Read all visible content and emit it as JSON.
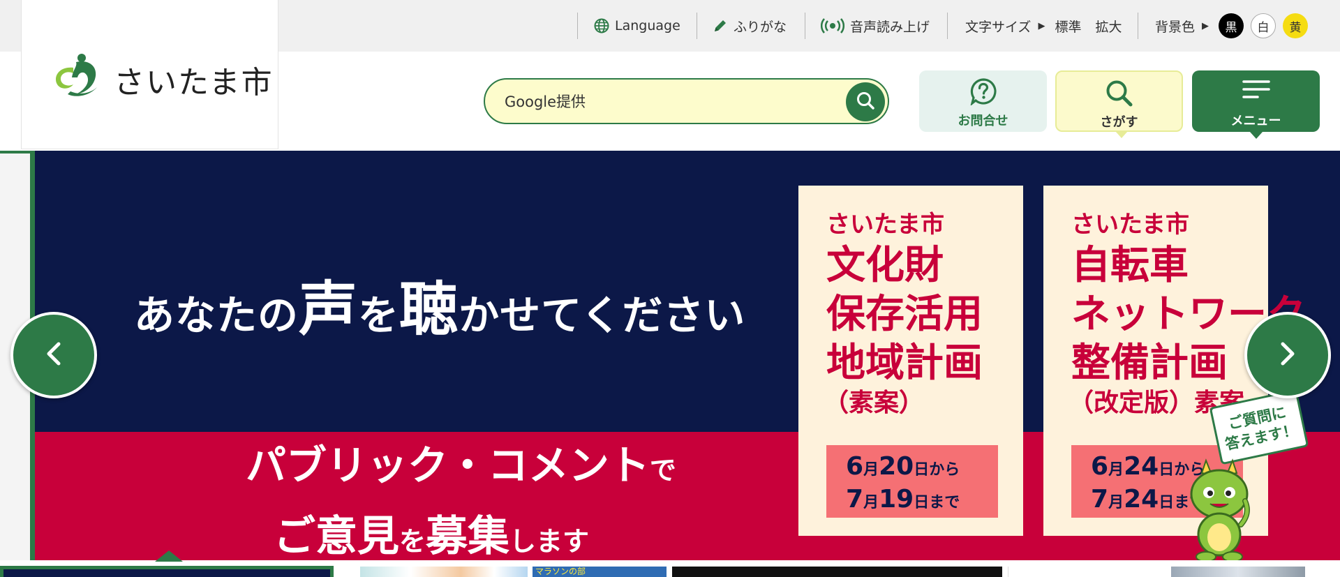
{
  "utility_bar": {
    "language": "Language",
    "furigana": "ふりがな",
    "read_aloud": "音声読み上げ",
    "text_size_label": "文字サイズ",
    "text_size_options": [
      "標準",
      "拡大"
    ],
    "bg_color_label": "背景色",
    "bg_color_options": [
      "黒",
      "白",
      "黄"
    ]
  },
  "header": {
    "logo_text": "さいたま市",
    "search_placeholder": "Google提供",
    "contact_label": "お問合せ",
    "find_label": "さがす",
    "menu_label": "メニュー"
  },
  "hero": {
    "headline_parts": [
      "あなたの",
      "声",
      "を",
      "聴",
      "かせてください"
    ],
    "sub_line1": [
      "パブリック・コメント",
      "で"
    ],
    "sub_line2": [
      "ご意見",
      "を",
      "募集",
      "します"
    ],
    "cards": [
      {
        "city": "さいたま市",
        "title_lines": [
          "文化財",
          "保存活用",
          "地域計画"
        ],
        "note": "（素案）",
        "date_lines": [
          [
            "6",
            "月",
            "20",
            "日から"
          ],
          [
            "7",
            "月",
            "19",
            "日まで"
          ]
        ]
      },
      {
        "city": "さいたま市",
        "title_lines": [
          "自転車",
          "ネットワーク",
          "整備計画"
        ],
        "note": "（改定版）素案",
        "date_lines": [
          [
            "6",
            "月",
            "24",
            "日から"
          ],
          [
            "7",
            "月",
            "24",
            "日まで"
          ]
        ]
      }
    ],
    "speech_bubble": [
      "ご質問に",
      "答えます！"
    ]
  },
  "thumbnails": {
    "marathon_label": "マラソンの部"
  },
  "colors": {
    "brand_green": "#2d7a47",
    "hero_navy": "#0c1848",
    "hero_red": "#c8003a",
    "card_bg": "#fef2dc",
    "date_bg": "#f57074",
    "search_bg": "#fdfccc"
  },
  "icons": {
    "language": "globe-icon",
    "furigana": "pencil-icon",
    "read_aloud": "broadcast-icon",
    "search": "magnifier-icon",
    "contact": "question-bubble-icon",
    "find": "magnifier-icon",
    "menu": "hamburger-icon",
    "prev": "chevron-left-icon",
    "next": "chevron-right-icon"
  }
}
